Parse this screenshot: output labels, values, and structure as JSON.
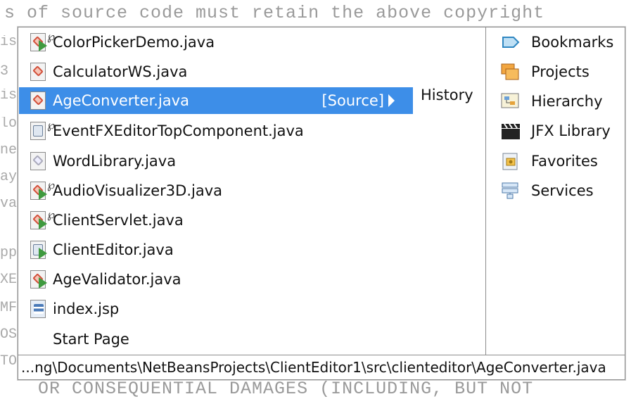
{
  "editor": {
    "code_top": "s of source code must retain the above copyright",
    "code_bottom": "   OR CONSEQUENTIAL DAMAGES (INCLUDING, BUT NOT",
    "gutter": [
      "is",
      "3",
      "is",
      "lo",
      "ne",
      "ay",
      "va",
      "",
      "pp",
      "XE",
      "MF",
      "OS",
      "TO"
    ]
  },
  "popup": {
    "files": [
      {
        "label": "ColorPickerDemo.java",
        "icon": "java-run-file-icon",
        "linked": true
      },
      {
        "label": "CalculatorWS.java",
        "icon": "java-file-icon",
        "linked": false
      },
      {
        "label": "AgeConverter.java",
        "icon": "java-file-icon",
        "linked": false,
        "selected": true
      },
      {
        "label": "EventFXEditorTopComponent.java",
        "icon": "form-file-icon",
        "linked": true
      },
      {
        "label": "WordLibrary.java",
        "icon": "java-plain-file-icon",
        "linked": false
      },
      {
        "label": "AudioVisualizer3D.java",
        "icon": "java-run-file-icon",
        "linked": true
      },
      {
        "label": "ClientServlet.java",
        "icon": "java-run-file-icon",
        "linked": true
      },
      {
        "label": "ClientEditor.java",
        "icon": "form-file-icon",
        "linked": false
      },
      {
        "label": "AgeValidator.java",
        "icon": "java-run-file-icon",
        "linked": false
      },
      {
        "label": "index.jsp",
        "icon": "jsp-file-icon",
        "linked": false
      },
      {
        "label": "Start Page",
        "icon": "",
        "linked": false
      }
    ],
    "selected_source_label": "[Source]",
    "history_label": "History",
    "windows": [
      {
        "label": "Bookmarks",
        "icon": "bookmark-icon"
      },
      {
        "label": "Projects",
        "icon": "projects-icon"
      },
      {
        "label": "Hierarchy",
        "icon": "hierarchy-icon"
      },
      {
        "label": "JFX Library",
        "icon": "clapperboard-icon"
      },
      {
        "label": "Favorites",
        "icon": "favorites-icon"
      },
      {
        "label": "Services",
        "icon": "services-icon"
      }
    ],
    "path": "...ng\\Documents\\NetBeansProjects\\ClientEditor1\\src\\clienteditor\\AgeConverter.java"
  },
  "colors": {
    "selection": "#3d8ee8",
    "border": "#8c8c8c"
  }
}
